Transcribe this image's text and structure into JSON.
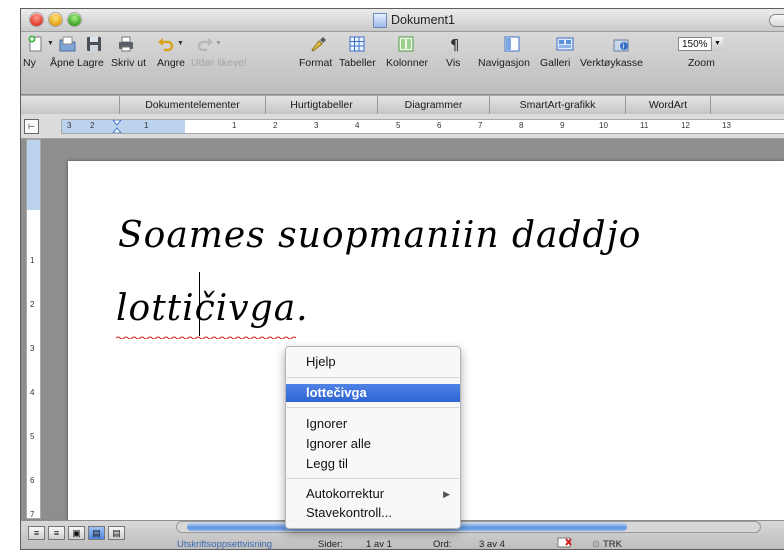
{
  "window": {
    "title": "Dokument1"
  },
  "toolbar": {
    "items": [
      {
        "label": "Ny",
        "icon": "new-document-icon"
      },
      {
        "label": "Åpne",
        "icon": "open-folder-icon"
      },
      {
        "label": "Lagre",
        "icon": "save-icon"
      },
      {
        "label": "Skriv ut",
        "icon": "print-icon"
      },
      {
        "label": "Angre",
        "icon": "undo-icon"
      },
      {
        "label": "Utfør likevel",
        "icon": "redo-icon",
        "disabled": true
      },
      {
        "label": "Format",
        "icon": "format-brush-icon"
      },
      {
        "label": "Tabeller",
        "icon": "table-icon"
      },
      {
        "label": "Kolonner",
        "icon": "columns-icon"
      },
      {
        "label": "Vis",
        "icon": "pilcrow-icon"
      },
      {
        "label": "Navigasjon",
        "icon": "navigation-pane-icon"
      },
      {
        "label": "Galleri",
        "icon": "gallery-icon"
      },
      {
        "label": "Verktøykasse",
        "icon": "toolbox-icon"
      },
      {
        "label": "Zoom",
        "icon": "zoom-icon"
      }
    ],
    "zoom_value": "150%"
  },
  "gallery_tabs": [
    "Dokumentelementer",
    "Hurtigtabeller",
    "Diagrammer",
    "SmartArt-grafikk",
    "WordArt"
  ],
  "ruler": {
    "numbers": [
      "3",
      "2",
      "1",
      "1",
      "2",
      "3",
      "4",
      "5",
      "6",
      "7",
      "8",
      "9",
      "10",
      "11",
      "12",
      "13"
    ],
    "vertical_numbers": [
      "1",
      "2",
      "3",
      "4",
      "5",
      "6",
      "7"
    ]
  },
  "document": {
    "line1": "Soames suopmaniin daddjo",
    "line2": "lottičivga."
  },
  "context_menu": {
    "items": [
      "Hjelp",
      "lottečivga",
      "Ignorer",
      "Ignorer alle",
      "Legg til",
      "Autokorrektur",
      "Stavekontroll..."
    ],
    "selected_index": 1
  },
  "statusbar": {
    "view_mode": "Utskriftsoppsettvisning",
    "pages_label": "Sider:",
    "pages_value": "1 av 1",
    "words_label": "Ord:",
    "words_value": "3 av 4",
    "track_label": "TRK"
  },
  "colors": {
    "menu_highlight": "#3a6fdc",
    "ruler_margin": "#bcd3ee",
    "spell_error": "#d02020"
  }
}
